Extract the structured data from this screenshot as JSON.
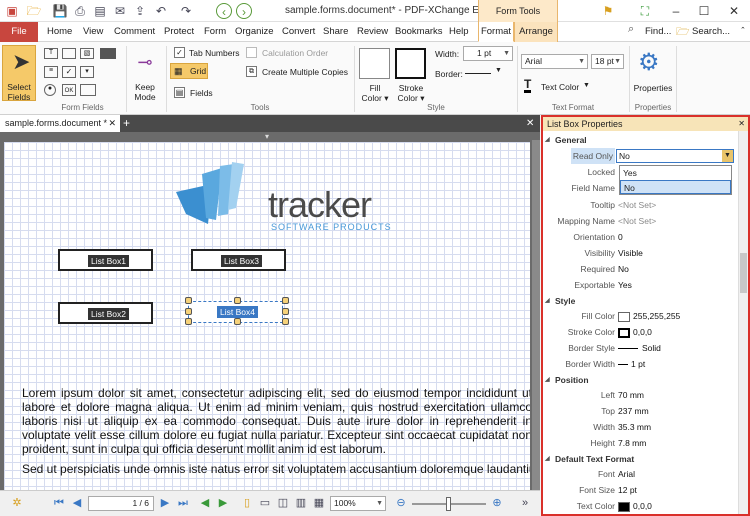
{
  "title_bar": {
    "title": "sample.forms.document* - PDF-XChange Editor",
    "context_label": "Form Tools",
    "find_label": "Find...",
    "search_label": "Search..."
  },
  "menu": {
    "file": "File",
    "items": [
      "Home",
      "View",
      "Comment",
      "Protect",
      "Form",
      "Organize",
      "Convert",
      "Share",
      "Review",
      "Bookmarks",
      "Help"
    ],
    "format": "Format",
    "arrange": "Arrange"
  },
  "ribbon": {
    "select_fields": "Select\nFields",
    "keep_mode": "Keep\nMode",
    "tab_numbers": "Tab Numbers",
    "calculation_order": "Calculation Order",
    "grid": "Grid",
    "create_multiple_copies": "Create Multiple Copies",
    "fields": "Fields",
    "fill_color": "Fill\nColor ▾",
    "stroke_color": "Stroke\nColor ▾",
    "width_label": "Width:",
    "width_value": "1 pt",
    "border_label": "Border:",
    "font_value": "Arial",
    "font_size": "18 pt",
    "text_color": "Text Color",
    "properties": "Properties",
    "groups": {
      "form_fields": "Form Fields",
      "tools": "Tools",
      "style": "Style",
      "text_format": "Text Format",
      "properties": "Properties"
    }
  },
  "doc_tab": {
    "name": "sample.forms.document *"
  },
  "document": {
    "logo_main": "tracker",
    "logo_sub": "SOFTWARE PRODUCTS",
    "list_boxes": [
      "List Box1",
      "List Box3",
      "List Box2",
      "List Box4"
    ],
    "para1": "Lorem ipsum dolor sit amet, consectetur adipiscing elit, sed do eiusmod tempor incididunt ut labore et dolore magna aliqua. Ut enim ad minim veniam, quis nostrud exercitation ullamco laboris nisi ut aliquip ex ea commodo consequat. Duis aute irure dolor in reprehenderit in voluptate velit esse cillum dolore eu fugiat nulla pariatur. Excepteur sint occaecat cupidatat non proident, sunt in culpa qui officia deserunt mollit anim id est laborum.",
    "para2": "Sed ut perspiciatis unde omnis iste natus error sit voluptatem accusantium doloremque laudantium, totam"
  },
  "status_bar": {
    "page_indicator": "1 / 6",
    "zoom": "100%"
  },
  "properties_pane": {
    "title": "List Box Properties",
    "sections": {
      "general": "General",
      "style": "Style",
      "position": "Position",
      "default_text_format": "Default Text Format"
    },
    "read_only_label": "Read Only",
    "read_only_value": "No",
    "dropdown_options": [
      "Yes",
      "No"
    ],
    "general_rows": [
      {
        "label": "Locked",
        "value": ""
      },
      {
        "label": "Field Name",
        "value": ""
      },
      {
        "label": "Tooltip",
        "value": "<Not Set>"
      },
      {
        "label": "Mapping Name",
        "value": "<Not Set>"
      },
      {
        "label": "Orientation",
        "value": "0"
      },
      {
        "label": "Visibility",
        "value": "Visible"
      },
      {
        "label": "Required",
        "value": "No"
      },
      {
        "label": "Exportable",
        "value": "Yes"
      }
    ],
    "style_rows": [
      {
        "label": "Fill Color",
        "value": "255,255,255",
        "swatch": "#ffffff"
      },
      {
        "label": "Stroke Color",
        "value": "0,0,0",
        "swatch": "#000000"
      },
      {
        "label": "Border Style",
        "value": "Solid"
      },
      {
        "label": "Border Width",
        "value": "1 pt"
      }
    ],
    "position_rows": [
      {
        "label": "Left",
        "value": "70 mm"
      },
      {
        "label": "Top",
        "value": "237 mm"
      },
      {
        "label": "Width",
        "value": "35.3 mm"
      },
      {
        "label": "Height",
        "value": "7.8 mm"
      }
    ],
    "text_rows": [
      {
        "label": "Font",
        "value": "Arial"
      },
      {
        "label": "Font Size",
        "value": "12 pt"
      },
      {
        "label": "Text Color",
        "value": "0,0,0",
        "swatch": "#000000"
      }
    ]
  },
  "colors": {
    "file_tab": "#c8463e",
    "context_tab": "#fbe3bd",
    "pane_border": "#d9302a",
    "logo_blue": "#3b8fd0"
  }
}
